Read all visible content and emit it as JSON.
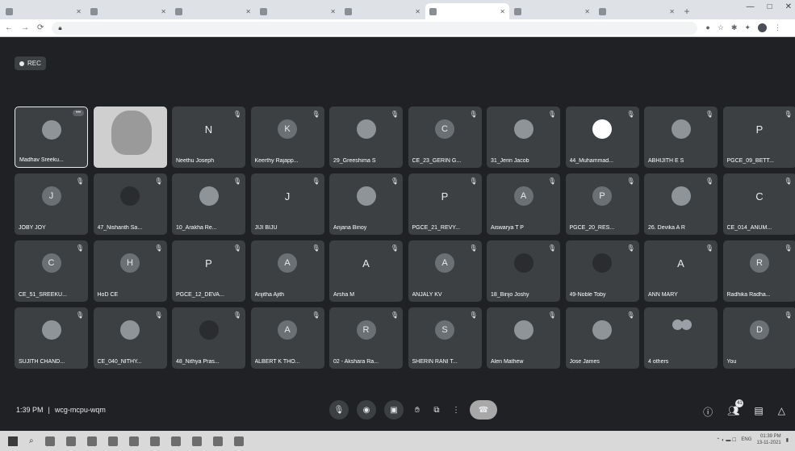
{
  "browser": {
    "tabs": [
      {
        "title": "",
        "active": false
      },
      {
        "title": "",
        "active": false
      },
      {
        "title": "",
        "active": false
      },
      {
        "title": "",
        "active": false
      },
      {
        "title": "",
        "active": false
      },
      {
        "title": "",
        "active": true
      },
      {
        "title": "",
        "active": false
      },
      {
        "title": "",
        "active": false
      }
    ],
    "new_tab": "+",
    "url": ""
  },
  "recording": {
    "label": "REC"
  },
  "participants": [
    {
      "name": "Madhav Sreeku...",
      "avatar": "icon",
      "style": "photo",
      "highlight": true,
      "muted": false,
      "menu": true
    },
    {
      "name": "",
      "avatar": "video",
      "style": "video",
      "muted": false
    },
    {
      "name": "Neethu Joseph",
      "avatar": "N",
      "style": "plain",
      "muted": true
    },
    {
      "name": "Keerthy Rajapp...",
      "avatar": "K",
      "style": "letter",
      "muted": true
    },
    {
      "name": "29_Greeshima S",
      "avatar": "",
      "style": "photo",
      "muted": true
    },
    {
      "name": "CE_23_GERIN G...",
      "avatar": "C",
      "style": "letter",
      "muted": true
    },
    {
      "name": "31_Jerin Jacob",
      "avatar": "",
      "style": "photo",
      "muted": true
    },
    {
      "name": "44_Muhammad...",
      "avatar": "",
      "style": "white",
      "muted": true
    },
    {
      "name": "ABHIJITH E S",
      "avatar": "",
      "style": "photo",
      "muted": true
    },
    {
      "name": "PGCE_09_BETT...",
      "avatar": "P",
      "style": "plain",
      "muted": true
    },
    {
      "name": "JOBY JOY",
      "avatar": "J",
      "style": "letter",
      "muted": true
    },
    {
      "name": "47_Nishanth Sa...",
      "avatar": "",
      "style": "dark",
      "muted": true
    },
    {
      "name": "10_Arakha Re...",
      "avatar": "",
      "style": "photo",
      "muted": true
    },
    {
      "name": "JIJI BIJU",
      "avatar": "J",
      "style": "plain",
      "muted": true
    },
    {
      "name": "Anjana Binoy",
      "avatar": "",
      "style": "photo",
      "muted": true
    },
    {
      "name": "PGCE_21_REVY...",
      "avatar": "P",
      "style": "plain",
      "muted": true
    },
    {
      "name": "Aiswarya T P",
      "avatar": "A",
      "style": "letter",
      "muted": true
    },
    {
      "name": "PGCE_20_RES...",
      "avatar": "P",
      "style": "letter",
      "muted": true
    },
    {
      "name": "26. Devika A R",
      "avatar": "",
      "style": "photo",
      "muted": true
    },
    {
      "name": "CE_014_ANUM...",
      "avatar": "C",
      "style": "plain",
      "muted": true
    },
    {
      "name": "CE_51_SREEKU...",
      "avatar": "C",
      "style": "letter",
      "muted": true
    },
    {
      "name": "HoD CE",
      "avatar": "H",
      "style": "letter",
      "muted": true
    },
    {
      "name": "PGCE_12_DEVA...",
      "avatar": "P",
      "style": "plain",
      "muted": true
    },
    {
      "name": "Anjitha Ajith",
      "avatar": "A",
      "style": "letter",
      "muted": true
    },
    {
      "name": "Arsha M",
      "avatar": "A",
      "style": "plain",
      "muted": true
    },
    {
      "name": "ANJALY KV",
      "avatar": "A",
      "style": "letter",
      "muted": true
    },
    {
      "name": "18_Binjo Joshy",
      "avatar": "",
      "style": "dark",
      "muted": true
    },
    {
      "name": "49-Noble Toby",
      "avatar": "",
      "style": "dark",
      "muted": true
    },
    {
      "name": "ANN MARY",
      "avatar": "A",
      "style": "plain",
      "muted": true
    },
    {
      "name": "Radhika Radha...",
      "avatar": "R",
      "style": "letter",
      "muted": true
    },
    {
      "name": "SUJITH CHAND...",
      "avatar": "",
      "style": "photo",
      "muted": true
    },
    {
      "name": "CE_040_NITHY...",
      "avatar": "",
      "style": "photo",
      "muted": true
    },
    {
      "name": "48_Nithya Pras...",
      "avatar": "",
      "style": "dark",
      "muted": true
    },
    {
      "name": "ALBERT K THO...",
      "avatar": "A",
      "style": "letter",
      "muted": true
    },
    {
      "name": "02 - Akshara Ra...",
      "avatar": "R",
      "style": "letter",
      "muted": true
    },
    {
      "name": "SHERIN RANI T...",
      "avatar": "S",
      "style": "letter",
      "muted": true
    },
    {
      "name": "Alen Mathew",
      "avatar": "",
      "style": "photo",
      "muted": true
    },
    {
      "name": "Jose James",
      "avatar": "",
      "style": "photo",
      "muted": true
    },
    {
      "name": "4 others",
      "avatar": "group",
      "style": "others",
      "muted": false
    },
    {
      "name": "You",
      "avatar": "D",
      "style": "letter",
      "muted": true
    }
  ],
  "bottom_bar": {
    "time": "1:39 PM",
    "separator": "|",
    "meeting_code": "wcg-mcpu-wqm",
    "participant_badge": "41"
  },
  "controls": [
    "mic-off-icon",
    "camera-off-icon",
    "captions-icon",
    "raise-hand-icon",
    "present-icon",
    "more-icon",
    "leave-call-icon"
  ],
  "taskbar": {
    "lang": "ENG",
    "clock_time": "01:39 PM",
    "clock_date": "13-11-2021"
  }
}
